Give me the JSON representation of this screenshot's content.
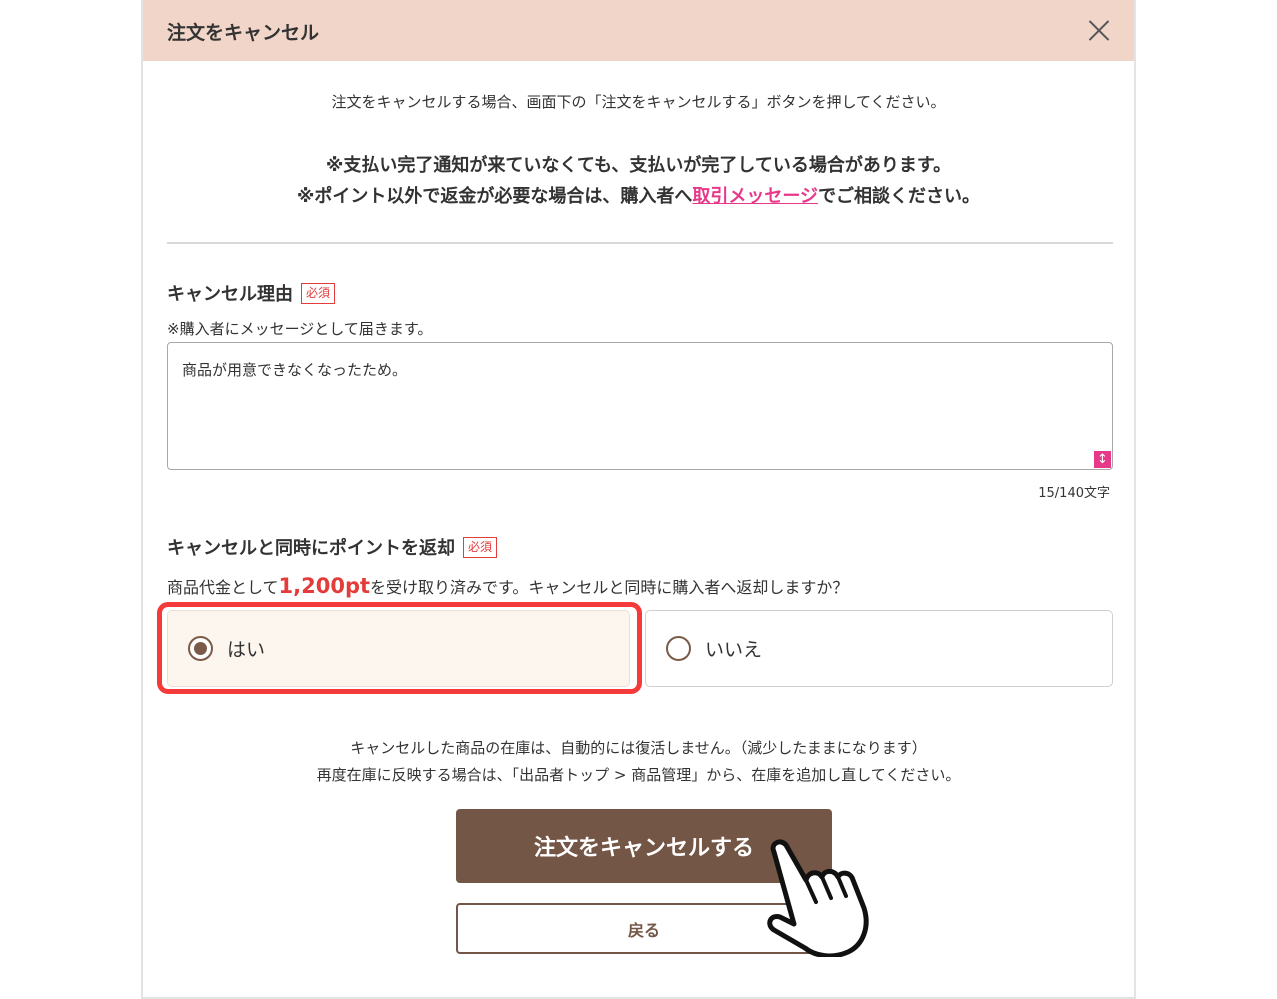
{
  "modal": {
    "title": "注文をキャンセル",
    "intro": "注文をキャンセルする場合、画面下の「注文をキャンセルする」ボタンを押してください。",
    "note_line1": "※支払い完了通知が来ていなくても、支払いが完了している場合があります。",
    "note_line2_before": "※ポイント以外で返金が必要な場合は、購入者へ",
    "note_line2_link": "取引メッセージ",
    "note_line2_after": "でご相談ください。"
  },
  "reason": {
    "label": "キャンセル理由",
    "required": "必須",
    "sub_note": "※購入者にメッセージとして届きます。",
    "value": "商品が用意できなくなったため。",
    "char_count": "15/140文字"
  },
  "points": {
    "label": "キャンセルと同時にポイントを返却",
    "required": "必須",
    "question_before": "商品代金として",
    "amount": "1,200pt",
    "question_after": "を受け取り済みです。キャンセルと同時に購入者へ返却しますか？",
    "options": [
      {
        "label": "はい",
        "checked": true
      },
      {
        "label": "いいえ",
        "checked": false
      }
    ]
  },
  "stock_note": {
    "line1": "キャンセルした商品の在庫は、自動的には復活しません。（減少したままになります）",
    "line2": "再度在庫に反映する場合は、「出品者トップ > 商品管理」から、在庫を追加し直してください。"
  },
  "buttons": {
    "cancel_order": "注文をキャンセルする",
    "back": "戻る"
  },
  "colors": {
    "header_bg": "#f1d5c9",
    "primary": "#745646",
    "link": "#e8388a",
    "accent_red": "#e43b3b",
    "highlight": "#f53a3a"
  },
  "icons": {
    "close": "close-icon",
    "resize": "resize-icon",
    "pointer": "pointing-hand-icon"
  }
}
